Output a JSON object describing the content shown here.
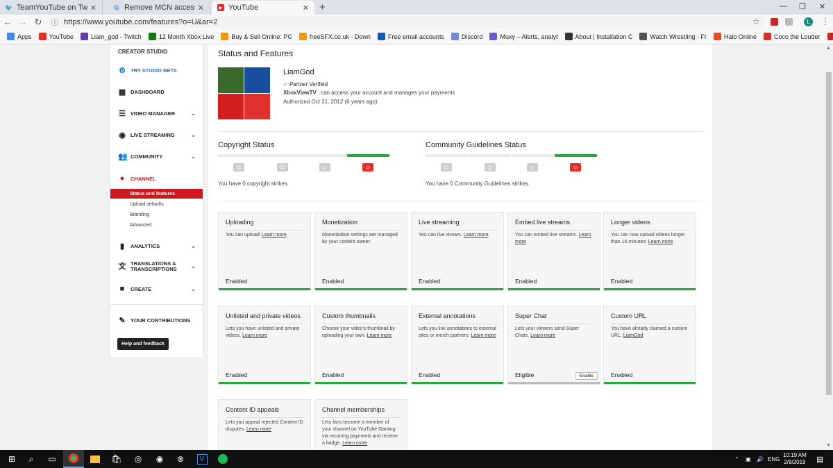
{
  "browser": {
    "tabs": [
      {
        "icon": "twitter-icon",
        "title": "TeamYouTube on Twitter: \"Hmm"
      },
      {
        "icon": "google-icon",
        "title": "Remove MCN access from your c"
      },
      {
        "icon": "youtube-icon",
        "title": "YouTube"
      }
    ],
    "url": "https://www.youtube.com/features?o=U&ar=2",
    "profile_letter": "L",
    "bookmarks": [
      "Apps",
      "YouTube",
      "Liam_god - Twitch",
      "12 Month Xbox Live",
      "Buy & Sell Online: PC",
      "freeSFX.co.uk - Down",
      "Free email accounts",
      "Discord",
      "Muxy – Alerts, analyt",
      "About | Installation C",
      "Watch Wrestling - Fr",
      "Halo Online",
      "Coco the Louder",
      "Gaming Headset Tec"
    ]
  },
  "sidebar": {
    "title": "CREATOR STUDIO",
    "try_beta": "TRY STUDIO BETA",
    "items": [
      {
        "label": "DASHBOARD",
        "icon": "dashboard-icon"
      },
      {
        "label": "VIDEO MANAGER",
        "icon": "video-manager-icon"
      },
      {
        "label": "LIVE STREAMING",
        "icon": "live-streaming-icon"
      },
      {
        "label": "COMMUNITY",
        "icon": "community-icon"
      },
      {
        "label": "CHANNEL",
        "icon": "channel-icon"
      },
      {
        "label": "ANALYTICS",
        "icon": "analytics-icon"
      },
      {
        "label": "TRANSLATIONS & TRANSCRIPTIONS",
        "icon": "translate-icon"
      },
      {
        "label": "CREATE",
        "icon": "create-icon"
      },
      {
        "label": "YOUR CONTRIBUTIONS",
        "icon": "contributions-icon"
      }
    ],
    "channel_sub": [
      "Status and features",
      "Upload defaults",
      "Branding",
      "Advanced"
    ],
    "help": "Help and feedback"
  },
  "main": {
    "title": "Status and Features",
    "channel_name": "LiamGod",
    "partner": "Partner Verified",
    "mcn_name": "XboxViewTV",
    "mcn_text": "can access your account and manages your payments",
    "authorized": "Authorized Oct 31, 2012 (6 years ago)",
    "copyright_title": "Copyright Status",
    "copyright_text": "You have 0 copyright strikes.",
    "community_title": "Community Guidelines Status",
    "community_text": "You have 0 Community Guidelines strikes.",
    "cards": [
      {
        "title": "Uploading",
        "desc": "You can upload!",
        "link": "Learn more",
        "status": "Enabled"
      },
      {
        "title": "Monetization",
        "desc": "Monetization settings are managed by your content owner.",
        "link": "",
        "status": "Enabled"
      },
      {
        "title": "Live streaming",
        "desc": "You can live stream.",
        "link": "Learn more",
        "status": "Enabled"
      },
      {
        "title": "Embed live streams",
        "desc": "You can embed live streams.",
        "link": "Learn more",
        "status": "Enabled"
      },
      {
        "title": "Longer videos",
        "desc": "You can now upload videos longer than 15 minutes!",
        "link": "Learn more",
        "status": "Enabled"
      },
      {
        "title": "Unlisted and private videos",
        "desc": "Lets you have unlisted and private videos.",
        "link": "Learn more",
        "status": "Enabled"
      },
      {
        "title": "Custom thumbnails",
        "desc": "Choose your video's thumbnail by uploading your own.",
        "link": "Learn more",
        "status": "Enabled"
      },
      {
        "title": "External annotations",
        "desc": "Lets you link annotations to external sites or merch partners.",
        "link": "Learn more",
        "status": "Enabled"
      },
      {
        "title": "Super Chat",
        "desc": "Lets your viewers send Super Chats.",
        "link": "Learn more",
        "status": "Eligible",
        "button": "Enable"
      },
      {
        "title": "Custom URL",
        "desc": "You have already claimed a custom URL:",
        "link": "LiamGod",
        "status": "Enabled"
      },
      {
        "title": "Content ID appeals",
        "desc": "Lets you appeal rejected Content ID disputes.",
        "link": "Learn more",
        "status": ""
      },
      {
        "title": "Channel memberships",
        "desc": "Lets fans become a member of your channel on YouTube Gaming via recurring payments and receive a badge.",
        "link": "Learn more",
        "status": ""
      }
    ]
  },
  "taskbar": {
    "lang": "ENG",
    "time": "10:19 AM",
    "date": "2/9/2019"
  },
  "colors": {
    "accent": "#cc181e",
    "enabled": "#2ba640",
    "link": "#167ac6"
  }
}
